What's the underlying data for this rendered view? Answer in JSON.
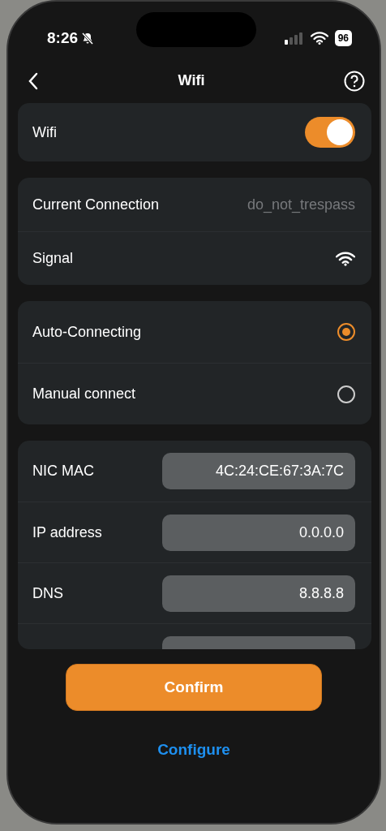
{
  "status_bar": {
    "time": "8:26",
    "battery": "96"
  },
  "header": {
    "title": "Wifi"
  },
  "wifi": {
    "label": "Wifi",
    "on": true
  },
  "connection": [
    {
      "kind": "text",
      "label": "Current Connection",
      "value": "do_not_trespass"
    },
    {
      "kind": "signal",
      "label": "Signal"
    }
  ],
  "modes": [
    {
      "label": "Auto-Connecting",
      "selected": true
    },
    {
      "label": "Manual connect",
      "selected": false
    }
  ],
  "fields": [
    {
      "kind": "field",
      "label": "NIC MAC",
      "value": "4C:24:CE:67:3A:7C"
    },
    {
      "kind": "field",
      "label": "IP address",
      "value": "0.0.0.0"
    },
    {
      "kind": "field",
      "label": "DNS",
      "value": "8.8.8.8"
    },
    {
      "kind": "cut"
    }
  ],
  "confirm": "Confirm",
  "configure": "Configure"
}
